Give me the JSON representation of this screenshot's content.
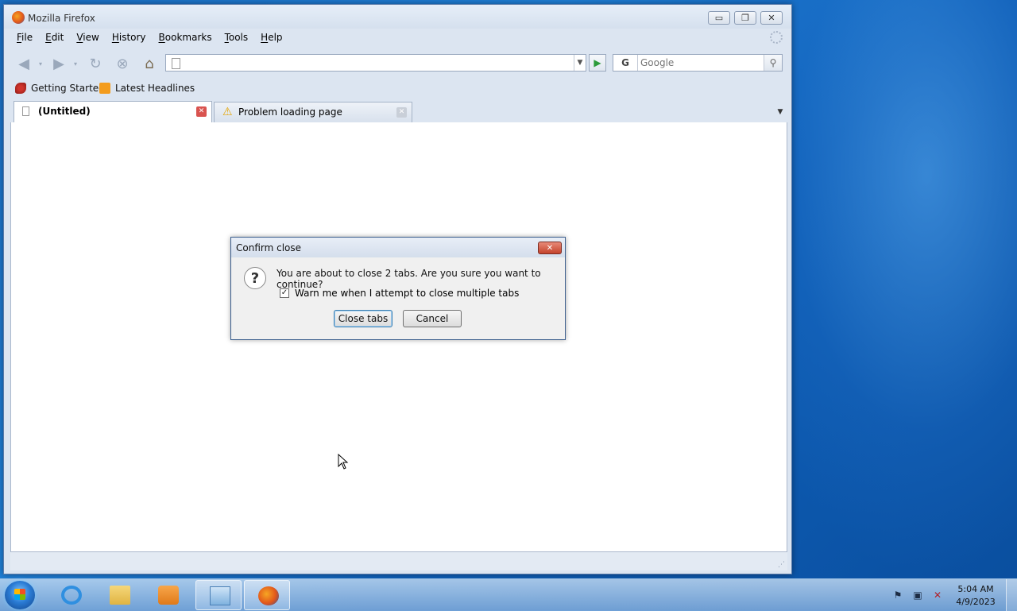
{
  "window": {
    "title": "Mozilla Firefox",
    "minimize": "▭",
    "maximize": "❐",
    "close": "✕"
  },
  "menubar": {
    "items": [
      "File",
      "Edit",
      "View",
      "History",
      "Bookmarks",
      "Tools",
      "Help"
    ]
  },
  "navigation": {
    "url_value": "",
    "search_engine": "G",
    "search_placeholder": "Google"
  },
  "bookmarks": {
    "items": [
      "Getting Started",
      "Latest Headlines"
    ]
  },
  "tabs": [
    {
      "label": "(Untitled)",
      "selected": true
    },
    {
      "label": "Problem loading page",
      "selected": false
    }
  ],
  "dialog": {
    "title": "Confirm close",
    "message": "You are about to close 2 tabs. Are you sure you want to continue?",
    "checkbox_label": "Warn me when I attempt to close multiple tabs",
    "checkbox_checked": true,
    "confirm_label": "Close tabs",
    "cancel_label": "Cancel"
  },
  "taskbar": {
    "time": "5:04 AM",
    "date": "4/9/2023"
  }
}
